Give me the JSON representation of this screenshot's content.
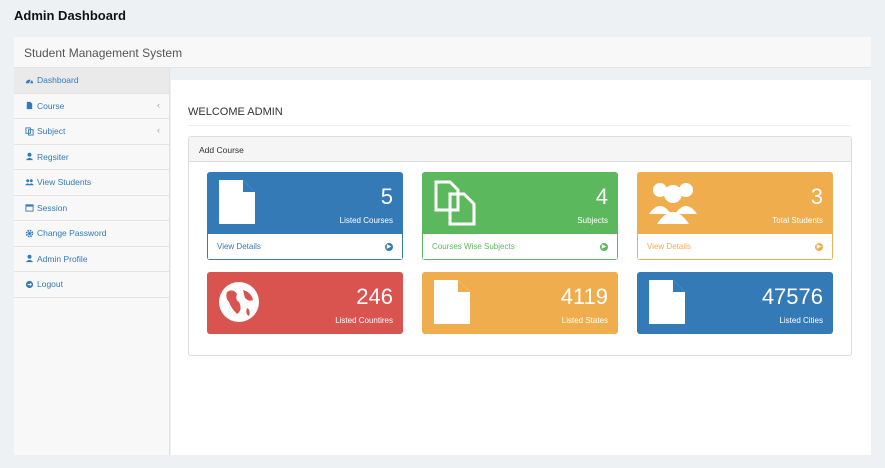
{
  "app_title": "Admin Dashboard",
  "brand": "Student Management System",
  "colors": {
    "blue": "#337ab7",
    "green": "#5cb85c",
    "orange": "#f0ad4e",
    "red": "#d9534f"
  },
  "sidebar": {
    "items": [
      {
        "label": "Dashboard",
        "icon": "dashboard-icon"
      },
      {
        "label": "Course",
        "icon": "file-icon",
        "chevron": "‹"
      },
      {
        "label": "Subject",
        "icon": "copy-icon",
        "chevron": "‹"
      },
      {
        "label": "Regsiter",
        "icon": "user-icon"
      },
      {
        "label": "View Students",
        "icon": "users-icon"
      },
      {
        "label": "Session",
        "icon": "calendar-icon"
      },
      {
        "label": "Change Password",
        "icon": "gear-icon"
      },
      {
        "label": "Admin Profile",
        "icon": "user-icon"
      },
      {
        "label": "Logout",
        "icon": "logout-icon"
      }
    ]
  },
  "main": {
    "heading": "WELCOME ADMIN",
    "panel_title": "Add Course",
    "cards": [
      {
        "value": "5",
        "label": "Listed Courses",
        "footer": "View Details",
        "color": "blue",
        "icon": "file-icon"
      },
      {
        "value": "4",
        "label": "Subjects",
        "footer": "Courses Wise Subjects",
        "color": "green",
        "icon": "copy-icon"
      },
      {
        "value": "3",
        "label": "Total Students",
        "footer": "View Details",
        "color": "orange",
        "icon": "users-icon"
      },
      {
        "value": "246",
        "label": "Listed Countires",
        "color": "red",
        "icon": "globe-icon"
      },
      {
        "value": "4119",
        "label": "Listed States",
        "color": "orange",
        "icon": "file-icon"
      },
      {
        "value": "47576",
        "label": "Listed Cities",
        "color": "blue",
        "icon": "file-icon"
      }
    ]
  }
}
